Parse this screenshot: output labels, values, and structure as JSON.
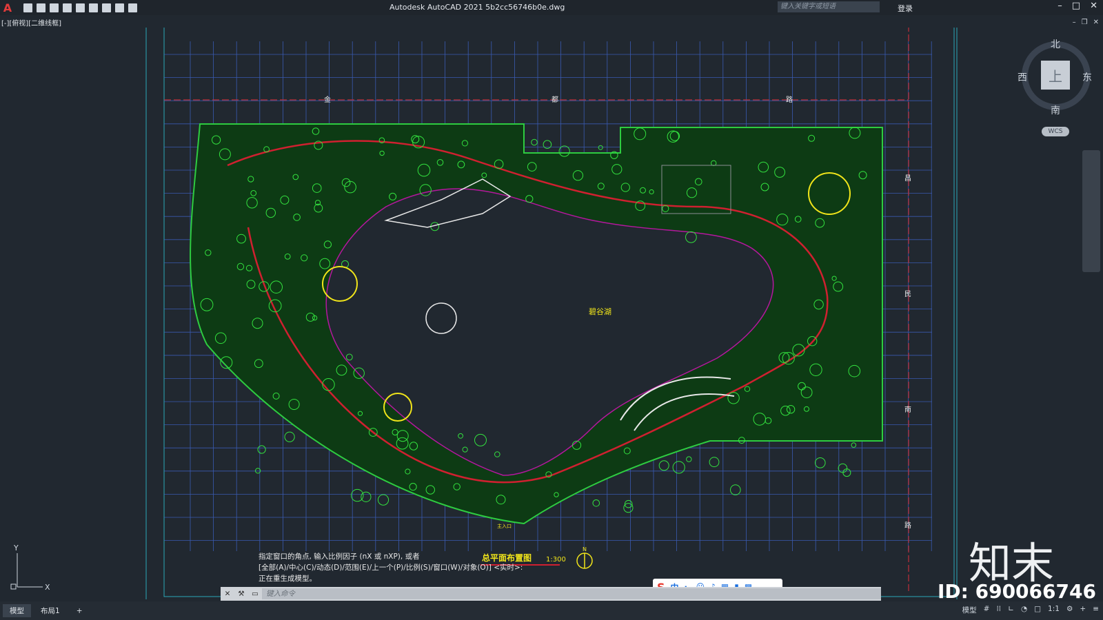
{
  "titlebar": {
    "app_title": "Autodesk AutoCAD 2021    5b2cc56746b0e.dwg",
    "search_placeholder": "键入关键字或短语",
    "login_label": "登录"
  },
  "viewport_label": "[-][俯视][二维线框]",
  "compass": {
    "north": "北",
    "south": "南",
    "east": "东",
    "west": "西",
    "top": "上",
    "wcs": "WCS"
  },
  "drawing": {
    "lake_label": "碧谷湖",
    "plan_title": "总平面布置图",
    "scale": "1:300",
    "north_mark": "N",
    "road_chars_top": [
      "金",
      "都",
      "路"
    ],
    "road_chars_right": [
      "昌",
      "民",
      "南",
      "路"
    ],
    "entrance_label": "主入口"
  },
  "command": {
    "history": [
      "指定窗口的角点, 输入比例因子 (nX 或 nXP), 或者",
      "[全部(A)/中心(C)/动态(D)/范围(E)/上一个(P)/比例(S)/窗口(W)/对象(O)] <实时>:",
      "正在重生成模型。"
    ],
    "placeholder": "键入命令"
  },
  "ime": {
    "label": "中"
  },
  "status": {
    "tabs": [
      "模型",
      "布局1"
    ],
    "add_tab": "+",
    "model_btn": "模型",
    "scale": "1:1"
  },
  "watermark": {
    "logo": "知末",
    "id": "ID: 690066746"
  },
  "ucs": {
    "x": "X",
    "y": "Y"
  }
}
